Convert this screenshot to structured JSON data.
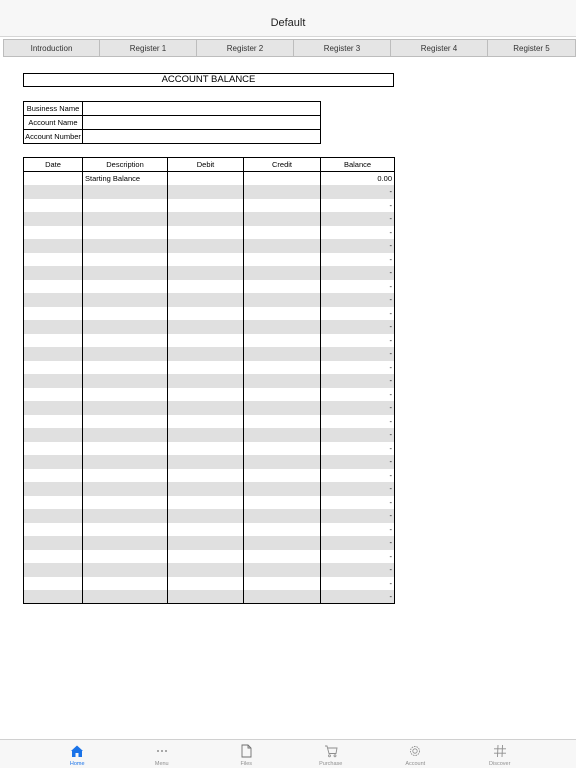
{
  "header": {
    "title": "Default"
  },
  "tabs": [
    "Introduction",
    "Register 1",
    "Register 2",
    "Register 3",
    "Register 4",
    "Register 5"
  ],
  "sheet": {
    "title": "ACCOUNT BALANCE",
    "info_labels": [
      "Business Name",
      "Account Name",
      "Account Number"
    ],
    "info_values": [
      "",
      "",
      ""
    ],
    "columns": [
      "Date",
      "Description",
      "Debit",
      "Credit",
      "Balance"
    ],
    "first_row": {
      "description": "Starting Balance",
      "balance": "0.00"
    },
    "empty_row_balance": "-",
    "empty_row_count": 31
  },
  "tabbar": {
    "items": [
      {
        "label": "Home",
        "icon": "home-icon",
        "active": true
      },
      {
        "label": "Menu",
        "icon": "more-dots-icon",
        "active": false
      },
      {
        "label": "Files",
        "icon": "file-icon",
        "active": false
      },
      {
        "label": "Purchase",
        "icon": "cart-icon",
        "active": false
      },
      {
        "label": "Account",
        "icon": "gear-icon",
        "active": false
      },
      {
        "label": "Discover",
        "icon": "hashtag-icon",
        "active": false
      }
    ]
  },
  "colors": {
    "accent": "#1a73e8",
    "inactive": "#8e8e8e",
    "alt_row": "#e0e0e0"
  }
}
